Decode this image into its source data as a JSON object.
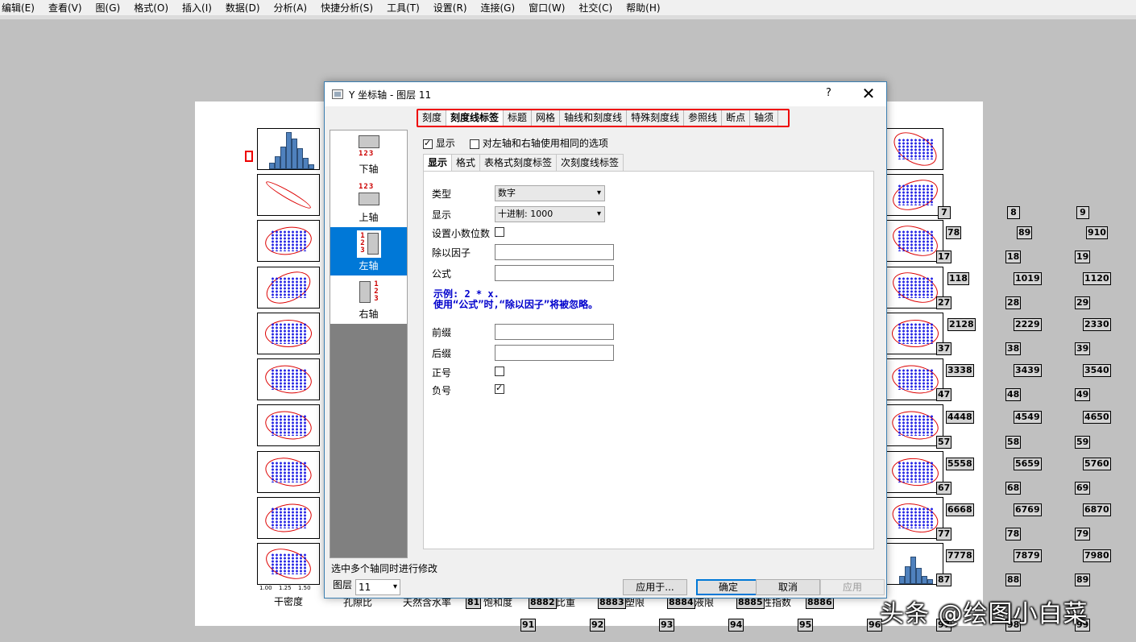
{
  "menubar": [
    {
      "label": "编辑(E)"
    },
    {
      "label": "查看(V)"
    },
    {
      "label": "图(G)"
    },
    {
      "label": "格式(O)"
    },
    {
      "label": "插入(I)"
    },
    {
      "label": "数据(D)"
    },
    {
      "label": "分析(A)"
    },
    {
      "label": "快捷分析(S)"
    },
    {
      "label": "工具(T)"
    },
    {
      "label": "设置(R)"
    },
    {
      "label": "连接(G)"
    },
    {
      "label": "窗口(W)"
    },
    {
      "label": "社交(C)"
    },
    {
      "label": "帮助(H)"
    }
  ],
  "graph": {
    "left_column_label": "干密度",
    "left_ticks_first": [
      "1.50",
      "1.25",
      "1.00"
    ],
    "xtick_labels": [
      "1.00",
      "1.25",
      "1.50"
    ],
    "row_labels": [
      "孔隙比",
      "天然含水率",
      "饱和度",
      "比重",
      "塑限",
      "液限",
      "塑性指数"
    ],
    "number_boxes": [
      "7",
      "8",
      "9",
      "78",
      "89",
      "910",
      "17",
      "18",
      "19",
      "118",
      "1019",
      "1120",
      "27",
      "28",
      "29",
      "2128",
      "2229",
      "2330",
      "37",
      "38",
      "39",
      "3338",
      "3439",
      "3540",
      "47",
      "48",
      "49",
      "4448",
      "4549",
      "4650",
      "57",
      "58",
      "59",
      "5558",
      "5659",
      "5760",
      "67",
      "68",
      "69",
      "6668",
      "6769",
      "6870",
      "77",
      "78",
      "79",
      "7778",
      "7879",
      "7980",
      "81",
      "8882",
      "8883",
      "8884",
      "8885",
      "8886",
      "87",
      "88",
      "89",
      "91",
      "92",
      "93",
      "94",
      "95",
      "96",
      "97",
      "98",
      "99"
    ]
  },
  "dialog": {
    "title": "Y 坐标轴 - 图层 11",
    "help": "?",
    "close": "✕",
    "main_tabs": [
      "刻度",
      "刻度线标签",
      "标题",
      "网格",
      "轴线和刻度线",
      "特殊刻度线",
      "参照线",
      "断点",
      "轴须"
    ],
    "active_main_tab": "刻度线标签",
    "axes": [
      {
        "label": "下轴",
        "glyph": "123"
      },
      {
        "label": "上轴",
        "glyph": "123"
      },
      {
        "label": "左轴",
        "glyph": "123"
      },
      {
        "label": "右轴",
        "glyph": "123"
      }
    ],
    "show_label": "显示",
    "same_options_label": "对左轴和右轴使用相同的选项",
    "sub_tabs": [
      "显示",
      "格式",
      "表格式刻度标签",
      "次刻度线标签"
    ],
    "fields": {
      "type_label": "类型",
      "type_value": "数字",
      "display_label": "显示",
      "display_value": "十进制: 1000",
      "decimal_label": "设置小数位数",
      "divide_label": "除以因子",
      "formula_label": "公式",
      "example_line1": "示例: 2 * x.",
      "example_line2": "使用“公式”时,“除以因子”将被忽略。",
      "prefix_label": "前缀",
      "suffix_label": "后缀",
      "plus_label": "正号",
      "minus_label": "负号"
    },
    "footer_text": "选中多个轴同时进行修改",
    "layer_label": "图层",
    "layer_value": "11",
    "buttons": {
      "apply_to": "应用于...",
      "ok": "确定",
      "cancel": "取消",
      "apply": "应用"
    }
  },
  "watermark": "头条 @绘图小白菜",
  "colors": {
    "accent": "#0078d7",
    "highlight": "#e00000",
    "data_points": "#0000e0",
    "histogram": "#4f81bd"
  }
}
